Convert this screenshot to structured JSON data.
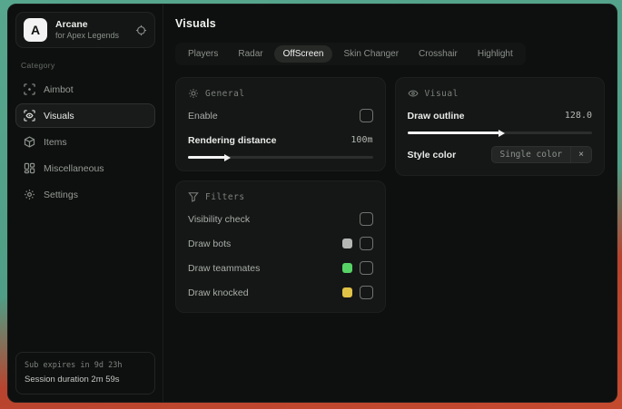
{
  "desktop": {
    "bg_teal": "#4f9e85",
    "bg_red": "#c44a2f"
  },
  "sidebar": {
    "logo_letter": "A",
    "title": "Arcane",
    "subtitle": "for Apex Legends",
    "category_label": "Category",
    "items": [
      {
        "label": "Aimbot",
        "icon": "crosshair-icon",
        "selected": false
      },
      {
        "label": "Visuals",
        "icon": "eye-scan-icon",
        "selected": true
      },
      {
        "label": "Items",
        "icon": "box-icon",
        "selected": false
      },
      {
        "label": "Miscellaneous",
        "icon": "grid-icon",
        "selected": false
      },
      {
        "label": "Settings",
        "icon": "gear-icon",
        "selected": false
      }
    ],
    "footer": {
      "sub_expires": "Sub expires in 9d 23h",
      "session_duration": "Session duration 2m 59s"
    }
  },
  "main": {
    "title": "Visuals",
    "tabs": [
      {
        "label": "Players",
        "selected": false
      },
      {
        "label": "Radar",
        "selected": false
      },
      {
        "label": "OffScreen",
        "selected": true
      },
      {
        "label": "Skin Changer",
        "selected": false
      },
      {
        "label": "Crosshair",
        "selected": false
      },
      {
        "label": "Highlight",
        "selected": false
      }
    ],
    "panels": {
      "general": {
        "title": "General",
        "icon": "sun-icon",
        "enable_label": "Enable",
        "enable_checked": false,
        "rendering_label": "Rendering distance",
        "rendering_value": "100m",
        "rendering_percent": 20
      },
      "visual": {
        "title": "Visual",
        "icon": "eye-icon",
        "outline_label": "Draw outline",
        "outline_value": "128.0",
        "outline_percent": 50,
        "style_label": "Style color",
        "style_value": "Single color",
        "style_clear": "×"
      },
      "filters": {
        "title": "Filters",
        "icon": "funnel-icon",
        "rows": [
          {
            "label": "Visibility check",
            "swatch": null,
            "checked": false
          },
          {
            "label": "Draw bots",
            "swatch": "#b5b7b5",
            "checked": false
          },
          {
            "label": "Draw teammates",
            "swatch": "#57d366",
            "checked": false
          },
          {
            "label": "Draw knocked",
            "swatch": "#e0c246",
            "checked": false
          }
        ]
      }
    }
  }
}
